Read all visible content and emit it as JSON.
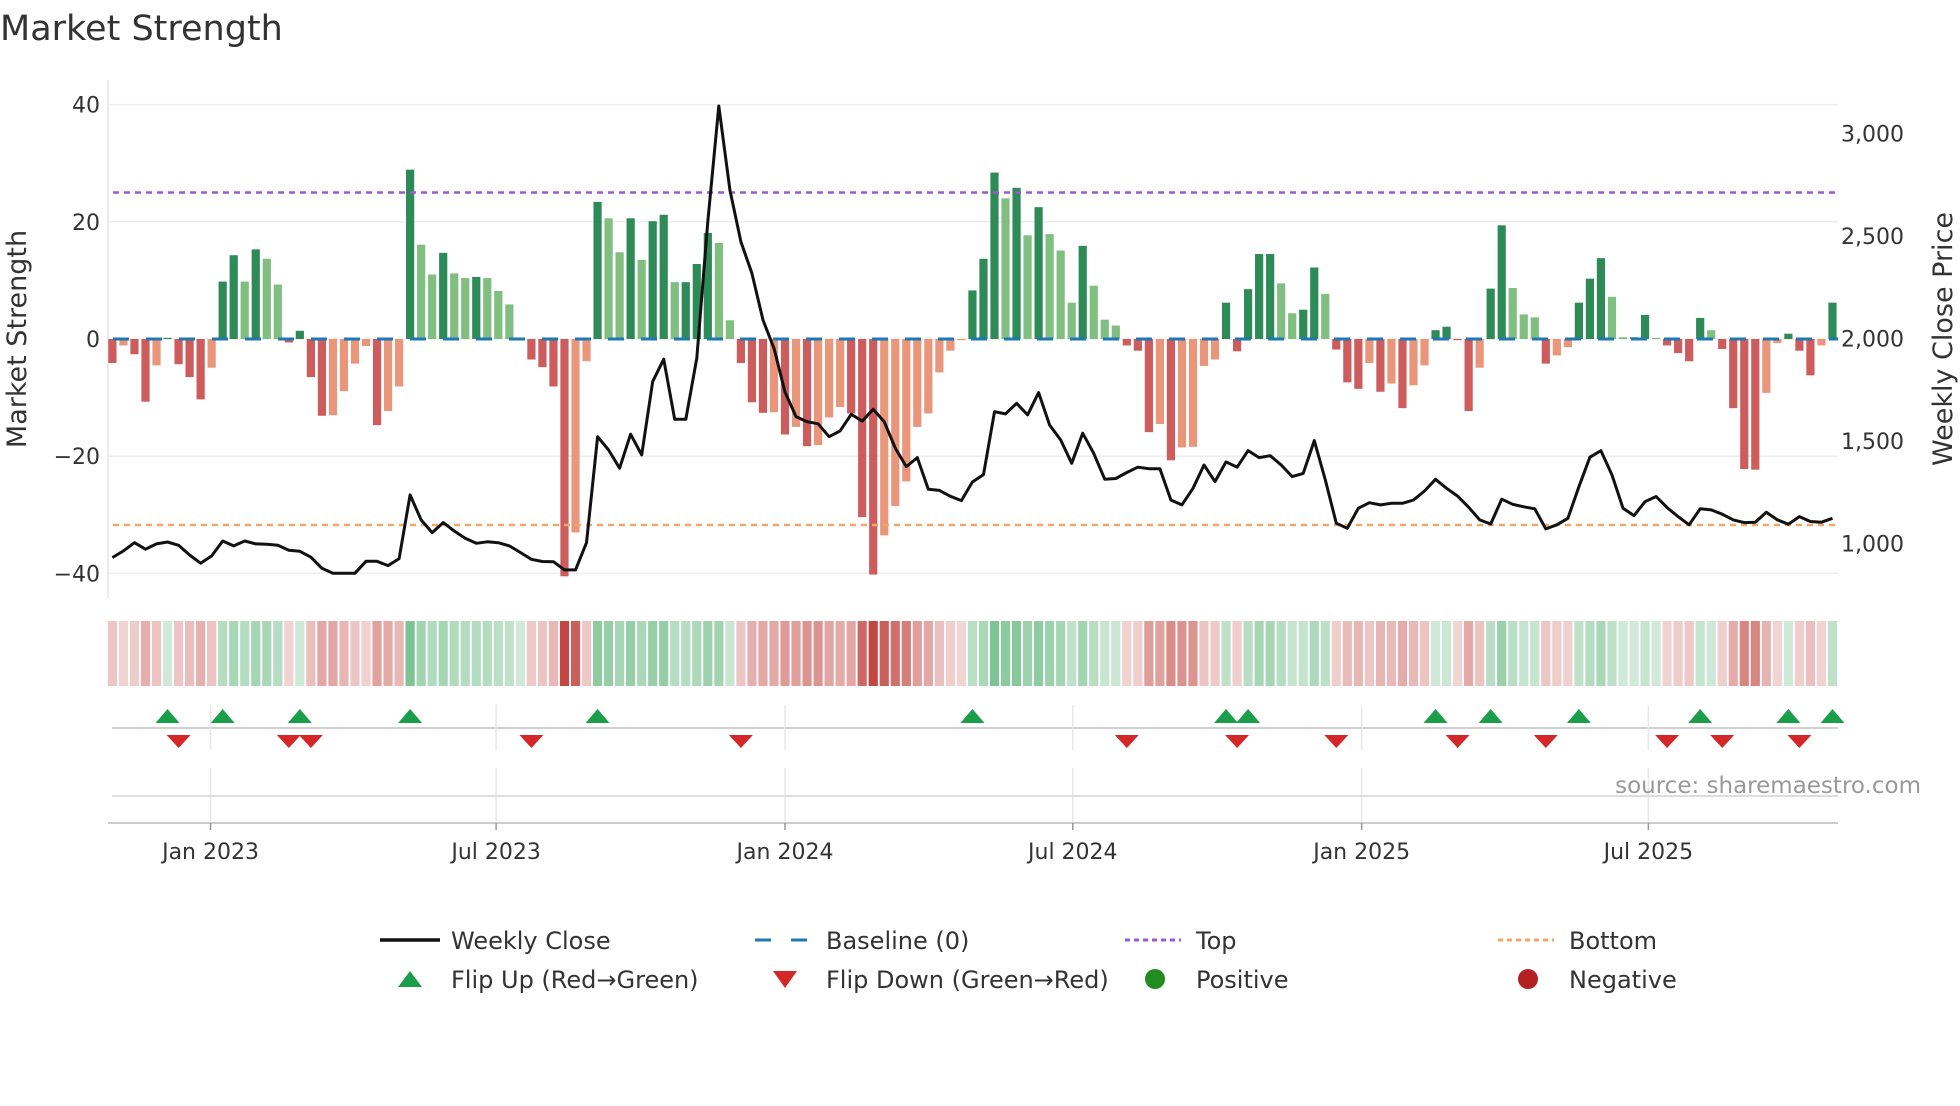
{
  "chart_data": {
    "type": "bar",
    "title": "Market Strength",
    "ylabel": "Market Strength",
    "y2label": "Weekly Close Price",
    "ylim": [
      -44.2,
      44.2
    ],
    "y2lim": [
      735,
      3262
    ],
    "xlim": [
      0.6,
      157.5
    ],
    "yticks": [
      {
        "v": 40,
        "label": "40"
      },
      {
        "v": 20,
        "label": "20"
      },
      {
        "v": 0,
        "label": "0"
      },
      {
        "v": -20,
        "label": "−20"
      },
      {
        "v": -40,
        "label": "−40"
      }
    ],
    "y2ticks": [
      {
        "v": 3000,
        "label": "3,000"
      },
      {
        "v": 2500,
        "label": "2,500"
      },
      {
        "v": 2000,
        "label": "2,000"
      },
      {
        "v": 1500,
        "label": "1,500"
      },
      {
        "v": 1000,
        "label": "1,000"
      }
    ],
    "xticks": [
      {
        "week": 9.9,
        "label": "Jan 2023"
      },
      {
        "week": 35.8,
        "label": "Jul 2023"
      },
      {
        "week": 62.0,
        "label": "Jan 2024"
      },
      {
        "week": 88.1,
        "label": "Jul 2024"
      },
      {
        "week": 114.3,
        "label": "Jan 2025"
      },
      {
        "week": 140.3,
        "label": "Jul 2025"
      }
    ],
    "top_level": 25,
    "bottom_level_price": 1091,
    "strength": [
      -4.1,
      -1.1,
      -2.6,
      -10.7,
      -4.5,
      0.2,
      -4.3,
      -6.5,
      -10.3,
      -4.9,
      9.8,
      14.3,
      9.8,
      15.3,
      13.7,
      9.3,
      -0.6,
      1.4,
      -6.5,
      -13.1,
      -13,
      -8.9,
      -4.2,
      -1.2,
      -14.7,
      -12.3,
      -8.1,
      28.9,
      16.1,
      11,
      14.7,
      11.2,
      10.4,
      10.6,
      10.4,
      8.2,
      5.9,
      0.2,
      -3.5,
      -4.8,
      -8.1,
      -40.5,
      -33,
      -3.8,
      23.4,
      20.6,
      14.8,
      20.6,
      13.5,
      20.1,
      21.2,
      9.7,
      9.7,
      12.8,
      18.1,
      16.4,
      3.2,
      -4.1,
      -10.8,
      -12.6,
      -12.5,
      -16.3,
      -15,
      -18.3,
      -18.1,
      -13.4,
      -11.6,
      -12.7,
      -30.4,
      -40.2,
      -33.5,
      -28.5,
      -24.3,
      -15,
      -12.7,
      -5.7,
      -2,
      -0.2,
      8.3,
      13.7,
      28.4,
      24,
      25.8,
      17.7,
      22.5,
      17.9,
      15.1,
      6.2,
      15.9,
      9.1,
      3.3,
      2.3,
      -1.1,
      -2,
      -15.9,
      -14.5,
      -20.7,
      -18.5,
      -18.4,
      -4.6,
      -3.5,
      6.2,
      -2.1,
      8.5,
      14.5,
      14.5,
      9.5,
      4.4,
      5,
      12.2,
      7.7,
      -1.8,
      -7.4,
      -8.5,
      -4.1,
      -9,
      -7.6,
      -11.8,
      -7.9,
      -4.5,
      1.5,
      2.1,
      -0.2,
      -12.3,
      -4.9,
      8.6,
      19.4,
      8.7,
      4.2,
      3.7,
      -4.2,
      -2.8,
      -1.4,
      6.2,
      10.3,
      13.8,
      7.2,
      0.3,
      0.3,
      4.1,
      0.2,
      -1.1,
      -2.4,
      -3.8,
      3.6,
      1.5,
      -1.7,
      -11.8,
      -22.2,
      -22.3,
      -9.2,
      -0.7,
      0.9,
      -2,
      -6.2,
      -1.1,
      6.2
    ],
    "weekly_close": [
      932,
      965,
      1005,
      973,
      999,
      1008,
      992,
      945,
      905,
      940,
      1013,
      989,
      1013,
      999,
      997,
      992,
      968,
      963,
      934,
      880,
      856,
      856,
      856,
      914,
      914,
      893,
      927,
      1238,
      1116,
      1054,
      1103,
      1062,
      1026,
      1002,
      1009,
      1005,
      989,
      957,
      924,
      913,
      912,
      872,
      872,
      1005,
      1522,
      1457,
      1368,
      1534,
      1433,
      1791,
      1900,
      1607,
      1607,
      1905,
      2571,
      3135,
      2726,
      2473,
      2319,
      2091,
      1953,
      1740,
      1620,
      1595,
      1585,
      1522,
      1550,
      1631,
      1598,
      1656,
      1595,
      1466,
      1376,
      1420,
      1266,
      1260,
      1231,
      1210,
      1301,
      1337,
      1644,
      1633,
      1685,
      1628,
      1737,
      1579,
      1506,
      1392,
      1539,
      1441,
      1314,
      1318,
      1347,
      1373,
      1366,
      1366,
      1213,
      1189,
      1270,
      1384,
      1303,
      1399,
      1373,
      1454,
      1420,
      1429,
      1384,
      1327,
      1343,
      1503,
      1311,
      1100,
      1075,
      1173,
      1200,
      1189,
      1197,
      1197,
      1213,
      1257,
      1314,
      1270,
      1232,
      1178,
      1116,
      1096,
      1217,
      1192,
      1180,
      1170,
      1072,
      1092,
      1124,
      1278,
      1422,
      1454,
      1335,
      1173,
      1137,
      1205,
      1230,
      1176,
      1132,
      1092,
      1170,
      1165,
      1144,
      1116,
      1103,
      1105,
      1153,
      1116,
      1095,
      1132,
      1108,
      1105,
      1124
    ],
    "flip_up_weeks": [
      6,
      11,
      18,
      28,
      45,
      79,
      102,
      104,
      121,
      126,
      134,
      145,
      153,
      157
    ],
    "flip_down_weeks": [
      7,
      17,
      19,
      39,
      58,
      93,
      103,
      112,
      123,
      131,
      142,
      147,
      154
    ],
    "legend": [
      {
        "label": "Weekly Close",
        "kind": "line",
        "color": "#111111"
      },
      {
        "label": "Baseline (0)",
        "kind": "dash",
        "color": "#1f77b4"
      },
      {
        "label": "Top",
        "kind": "dot",
        "color": "#9b59d6"
      },
      {
        "label": "Bottom",
        "kind": "dot",
        "color": "#f0a868"
      },
      {
        "label": "Flip Up (Red→Green)",
        "kind": "up",
        "color": "#1a9e4a"
      },
      {
        "label": "Flip Down (Green→Red)",
        "kind": "down",
        "color": "#d62728"
      },
      {
        "label": "Positive",
        "kind": "circle",
        "color": "#228b22"
      },
      {
        "label": "Negative",
        "kind": "circle",
        "color": "#b22222"
      }
    ],
    "legend_position": "bottom",
    "colors": {
      "pos_dark": "#2e8b57",
      "pos_light": "#80bf80",
      "neg_dark": "#cd5c5c",
      "neg_light": "#e9967a",
      "baseline": "#1f77b4",
      "top": "#9b59d6",
      "bottom": "#f0a868",
      "close": "#111111"
    }
  },
  "source": "source: sharemaestro.com"
}
